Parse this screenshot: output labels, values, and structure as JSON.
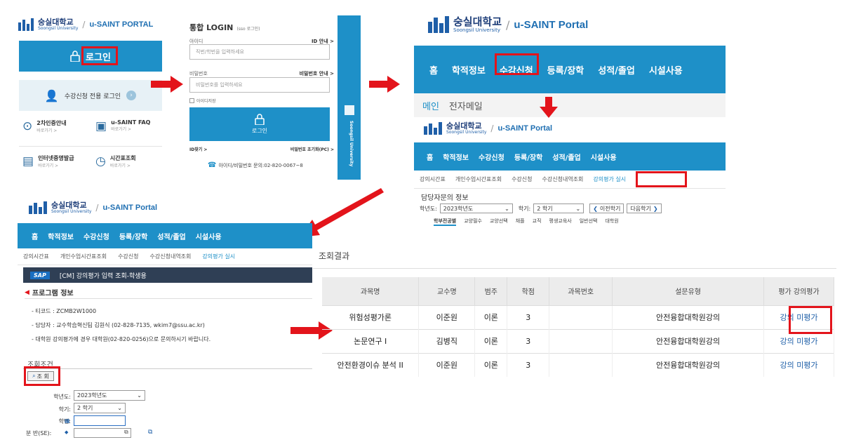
{
  "brand": {
    "kname": "숭실대학교",
    "ename": "Soongsil University",
    "portal": "u-SAINT PORTAL",
    "portal2": "u-SAINT Portal",
    "vertical": "Soongsil University"
  },
  "panel1": {
    "login": "로그인",
    "sugang_login": "수강신청 전용 로그인",
    "items": [
      {
        "title": "2차인증안내",
        "sub": "바로가기 >"
      },
      {
        "title": "u-SAINT FAQ",
        "sub": "바로가기 >"
      },
      {
        "title": "인터넷증명발급",
        "sub": "바로가기 >"
      },
      {
        "title": "시간표조회",
        "sub": "바로가기 >"
      }
    ]
  },
  "panel2": {
    "title": "통합 LOGIN",
    "title_small": "(sso 로그인)",
    "id_label": "아이디",
    "id_link": "ID 안내 >",
    "id_placeholder": "직번/학번을 입력하세요",
    "pw_label": "비밀번호",
    "pw_link": "비밀번호 안내 >",
    "pw_placeholder": "비밀번호를 입력하세요",
    "remember": "아이디저장",
    "login_btn": "로그인",
    "find_id": "ID찾기 >",
    "reset_pw": "비밀번호 초기화(PC) >",
    "help": "아이디/비밀번호 문의:02-820-0067~8"
  },
  "panel3": {
    "nav": [
      "홈",
      "학적정보",
      "수강신청",
      "등록/장학",
      "성적/졸업",
      "시설사용"
    ],
    "sub": [
      "메인",
      "전자메일"
    ]
  },
  "panel4": {
    "nav": [
      "홈",
      "학적정보",
      "수강신청",
      "등록/장학",
      "성적/졸업",
      "시설사용"
    ],
    "sub": [
      "강의시간표",
      "개인수업시간표조회",
      "수강신청",
      "수강신청내역조회",
      "강의평가 실시"
    ],
    "section": "담당자문의 정보",
    "year_label": "학년도:",
    "year_value": "2023학년도",
    "term_label": "학기:",
    "term_value": "2 학기",
    "prev": "이전학기",
    "next": "다음학기",
    "tabs": [
      "학부전공별",
      "교양필수",
      "교양선택",
      "채플",
      "교직",
      "평생교육사",
      "일반선택",
      "대학원"
    ]
  },
  "panel5": {
    "nav": [
      "홈",
      "학적정보",
      "수강신청",
      "등록/장학",
      "성적/졸업",
      "시설사용"
    ],
    "sub": [
      "강의시간표",
      "개인수업시간표조회",
      "수강신청",
      "수강신청내역조회",
      "강의평가 실시"
    ],
    "sap": "SAP",
    "bar_title": "[CM] 강의평가 입력 조회-학생용",
    "program_info": "프로그램 정보",
    "tcode": "- 티코드 : ZCMB2W1000",
    "manager": "- 담당자 : 교수학습혁신팀 김원식 (02-828-7135, wkim7@ssu.ac.kr)",
    "grad": "- 대학원 강의평가에 경우 대학원(02-820-0256)으로 문의하시기 바랍니다.",
    "cond": "조회조건",
    "search_btn": "조 회",
    "year_label": "학년도:",
    "year_value": "2023학년도",
    "term_label": "학기:",
    "term_value": "2 학기",
    "sid_label": "학번:",
    "section_label": "분 반(SE):"
  },
  "panel6": {
    "title": "조회결과",
    "headers": [
      "과목명",
      "교수명",
      "범주",
      "학점",
      "과목번호",
      "설문유형",
      "평가 강의평가"
    ],
    "rows": [
      {
        "subject": "위험성평가론",
        "prof": "이준원",
        "cat": "이론",
        "credit": "3",
        "no": "",
        "type": "안전융합대학원강의",
        "eval": "강의 미평가"
      },
      {
        "subject": "논문연구 I",
        "prof": "김병직",
        "cat": "이론",
        "credit": "3",
        "no": "",
        "type": "안전융합대학원강의",
        "eval": "강의 미평가"
      },
      {
        "subject": "안전환경이슈 분석 II",
        "prof": "이준원",
        "cat": "이론",
        "credit": "3",
        "no": "",
        "type": "안전융합대학원강의",
        "eval": "강의 미평가"
      }
    ]
  },
  "colors": {
    "accent": "#1e90c8",
    "red": "#e3141b",
    "navy": "#1f3f7a",
    "dark": "#2f3f55"
  }
}
